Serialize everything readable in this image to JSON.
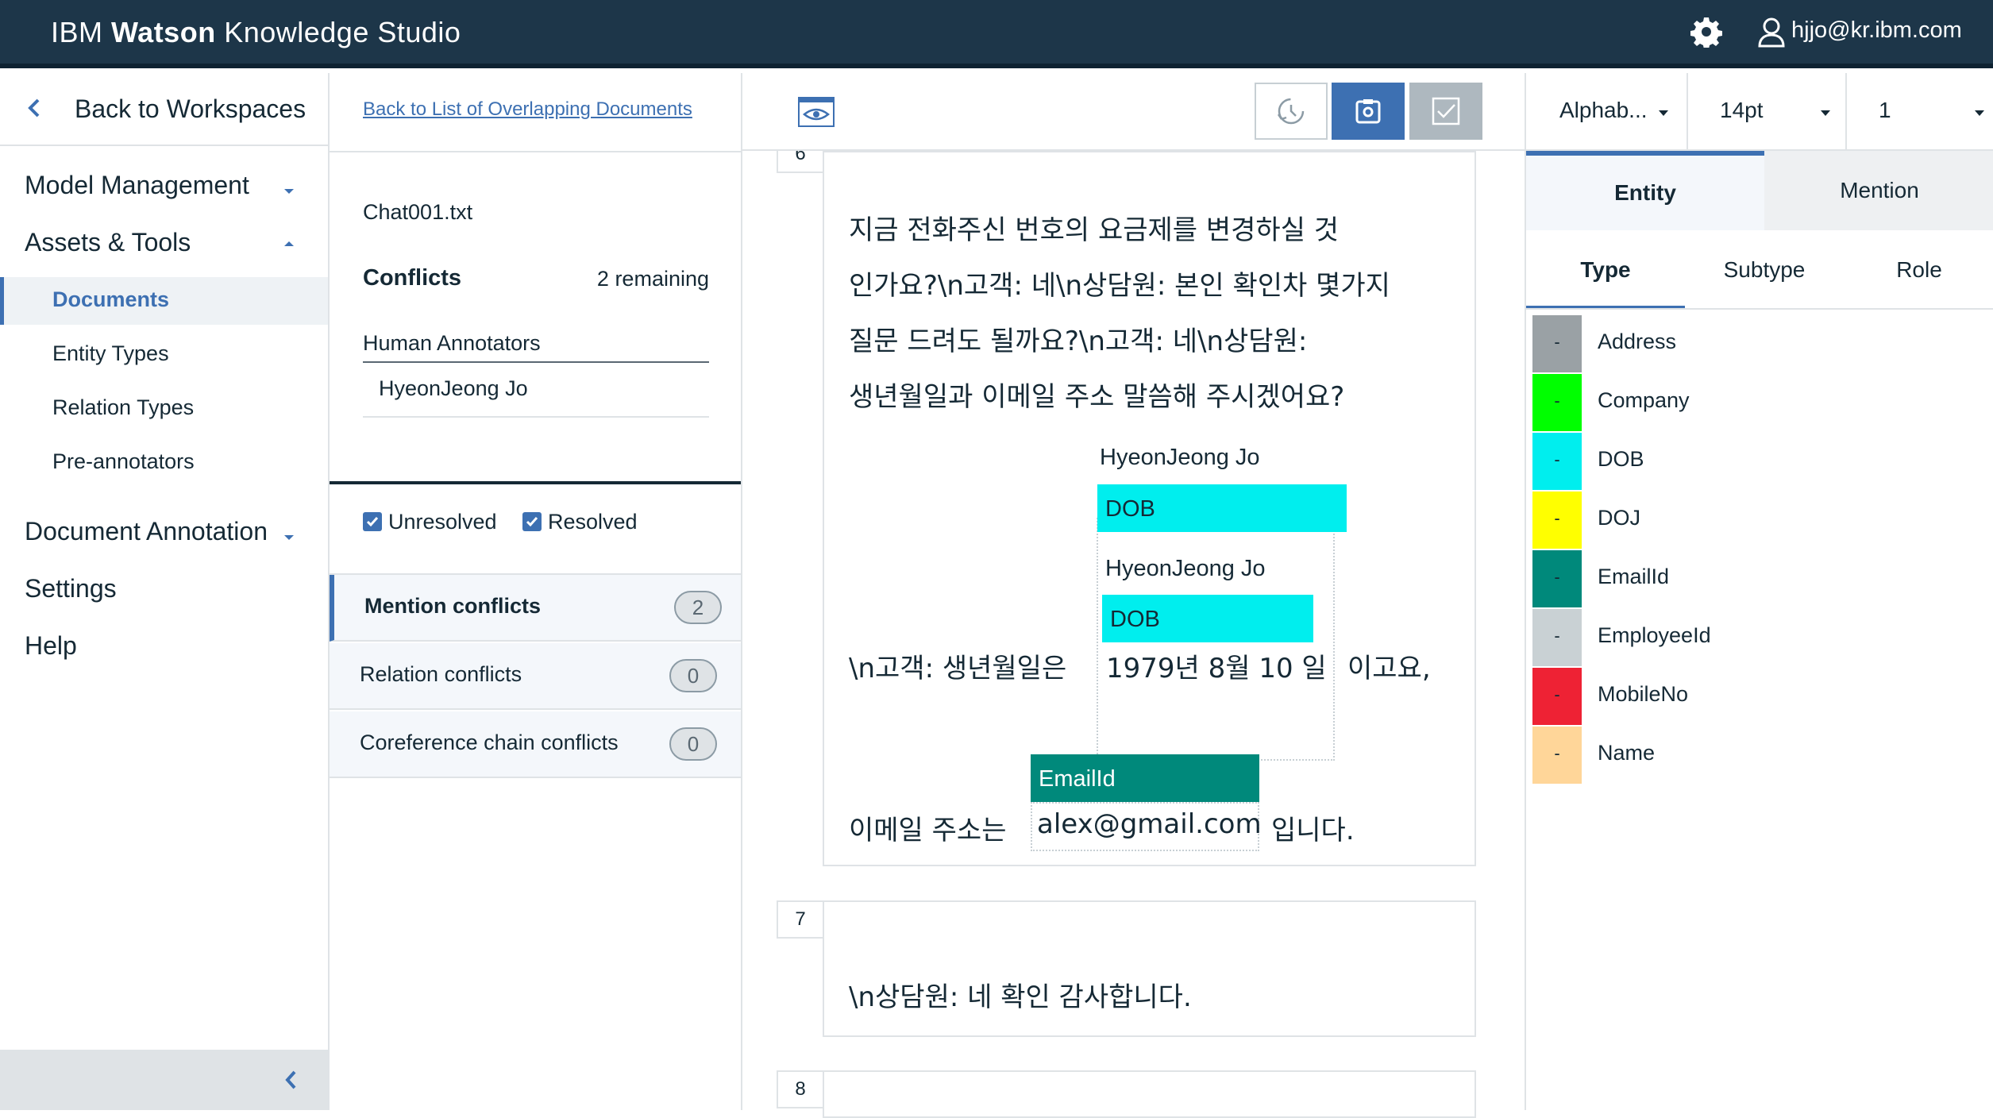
{
  "header": {
    "brand_prefix": "IBM",
    "brand_bold": "Watson",
    "brand_suffix": "Knowledge Studio",
    "user_email": "hjjo@kr.ibm.com"
  },
  "nav": {
    "back_label": "Back to Workspaces",
    "model_management": "Model Management",
    "assets_tools": "Assets & Tools",
    "documents": "Documents",
    "entity_types": "Entity Types",
    "relation_types": "Relation Types",
    "pre_annotators": "Pre-annotators",
    "document_annotation": "Document Annotation",
    "settings": "Settings",
    "help": "Help"
  },
  "conflicts": {
    "back_link": "Back to List of Overlapping Documents",
    "doc_name": "Chat001.txt",
    "title": "Conflicts",
    "remaining": "2 remaining",
    "human_annotators_label": "Human Annotators",
    "annotator_name": "HyeonJeong Jo",
    "filter_unresolved": "Unresolved",
    "filter_resolved": "Resolved",
    "rows": [
      {
        "label": "Mention conflicts",
        "count": "2"
      },
      {
        "label": "Relation conflicts",
        "count": "0"
      },
      {
        "label": "Coreference chain conflicts",
        "count": "0"
      }
    ]
  },
  "document": {
    "sentence6_num": "6",
    "sentence6_lines": [
      "지금 전화주신 번호의 요금제를 변경하실 것",
      "인가요?\\n고객: 네\\n상담원: 본인 확인차 몇가지",
      "질문 드려도 될까요?\\n고객: 네\\n상담원:",
      "생년월일과 이메일 주소 말씀해 주시겠어요?"
    ],
    "annotator_a": "HyeonJeong Jo",
    "annotator_b": "HyeonJeong Jo",
    "dob_label": "DOB",
    "dob_pre": "\\n고객: 생년월일은",
    "dob_text": "1979년 8월 10 일",
    "dob_post": "이고요,",
    "email_label": "EmailId",
    "email_pre": "이메일 주소는",
    "email_text": "alex@gmail.com",
    "email_post": "입니다.",
    "sentence7_num": "7",
    "sentence7_text": "\\n상담원: 네 확인 감사합니다.",
    "sentence8_num": "8"
  },
  "right_panel": {
    "sort_value": "Alphab...",
    "font_size": "14pt",
    "level": "1",
    "tab_entity": "Entity",
    "tab_mention": "Mention",
    "subtab_type": "Type",
    "subtab_subtype": "Subtype",
    "subtab_role": "Role",
    "entity_types": [
      {
        "name": "Address",
        "color": "#9aa1a5",
        "mark": "-"
      },
      {
        "name": "Company",
        "color": "#00ff00",
        "mark": "-"
      },
      {
        "name": "DOB",
        "color": "#00eeee",
        "mark": "-"
      },
      {
        "name": "DOJ",
        "color": "#ffff00",
        "mark": "-"
      },
      {
        "name": "EmailId",
        "color": "#00897b",
        "mark": "-"
      },
      {
        "name": "EmployeeId",
        "color": "#c9d1d4",
        "mark": "-"
      },
      {
        "name": "MobileNo",
        "color": "#ee2234",
        "mark": "-"
      },
      {
        "name": "Name",
        "color": "#ffd699",
        "mark": "-"
      }
    ]
  }
}
